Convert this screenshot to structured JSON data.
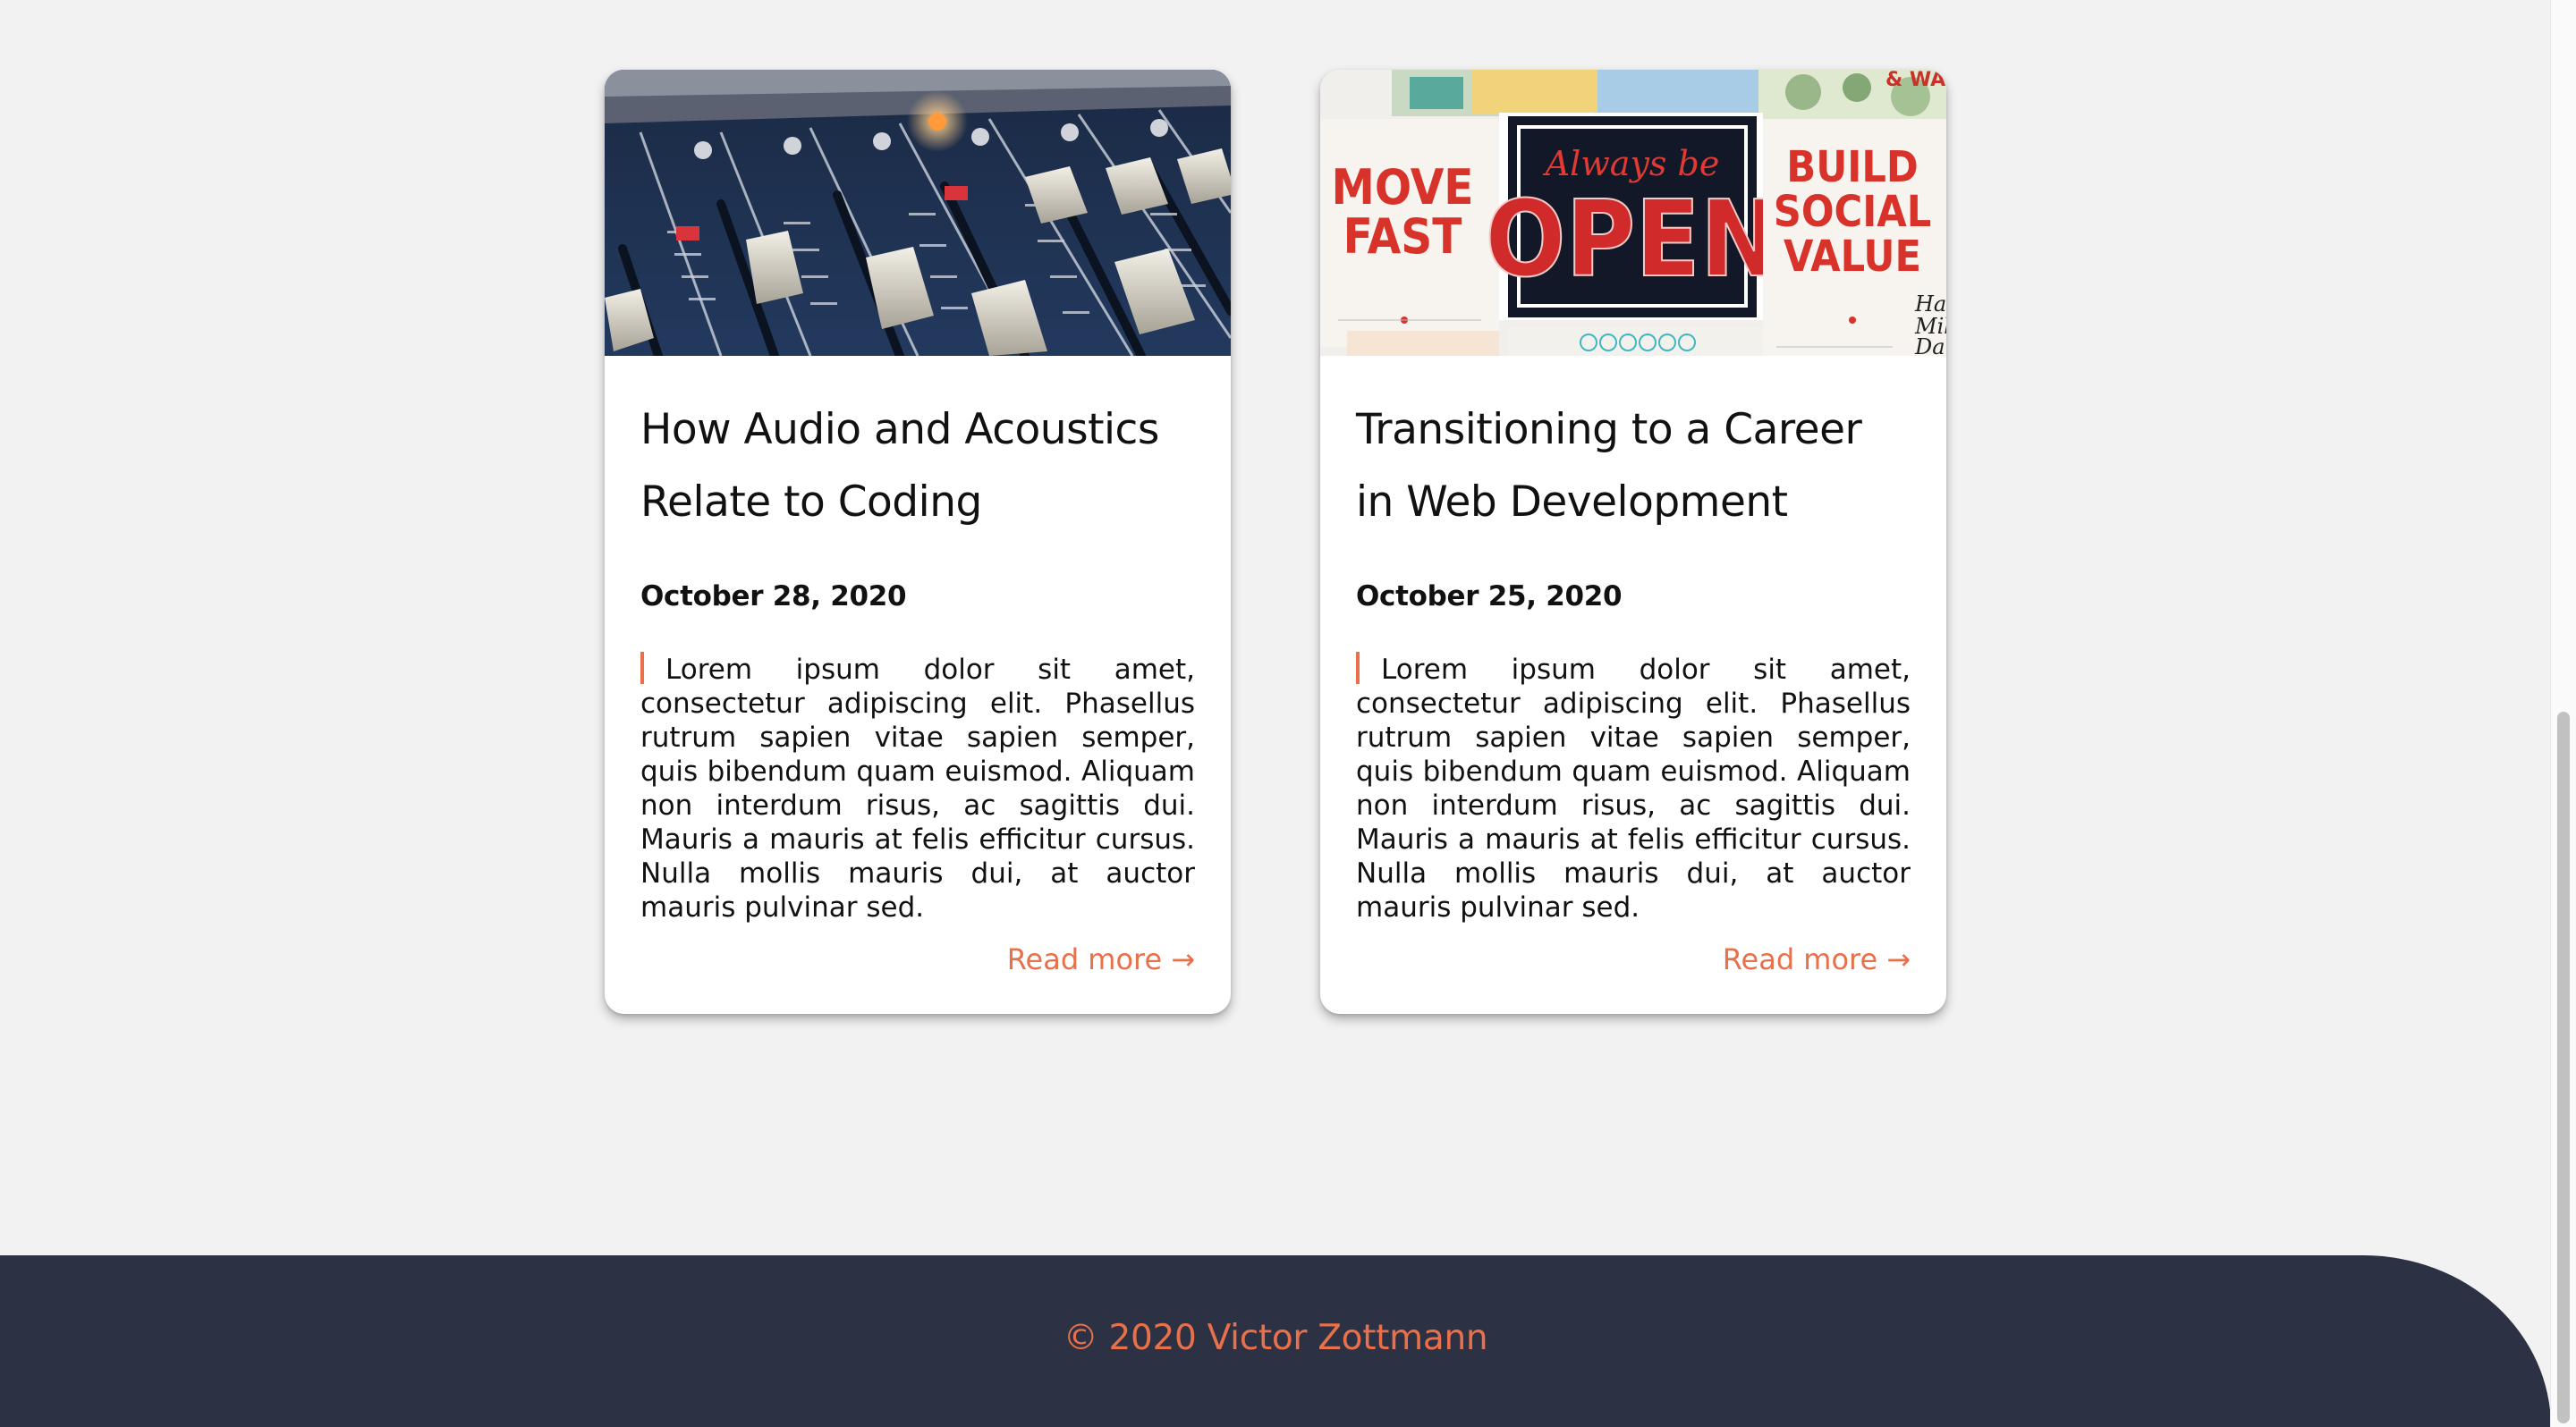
{
  "posts": [
    {
      "title": "How Audio and Acoustics Relate to Coding",
      "date": "October 28, 2020",
      "excerpt": "Lorem ipsum dolor sit amet, consectetur adipiscing elit. Phasellus rutrum sapien vitae sapien semper, quis bibendum quam euismod. Aliquam non interdum risus, ac sagittis dui. Mauris a mauris at felis efficitur cursus. Nulla mollis mauris dui, at auctor mauris pulvinar sed.",
      "read_more": "Read more",
      "arrow": "→"
    },
    {
      "title": "Transitioning to a Career in Web Development",
      "date": "October 25, 2020",
      "excerpt": "Lorem ipsum dolor sit amet, consectetur adipiscing elit. Phasellus rutrum sapien vitae sapien semper, quis bibendum quam euismod. Aliquam non interdum risus, ac sagittis dui. Mauris a mauris at felis efficitur cursus. Nulla mollis mauris dui, at auctor mauris pulvinar sed.",
      "read_more": "Read more",
      "arrow": "→",
      "image_text": {
        "sign_top": "Always be",
        "sign_main": "OPEN",
        "left_poster": [
          "MOVE",
          "FAST"
        ],
        "right_poster": [
          "BUILD",
          "SOCIAL",
          "VALUE"
        ]
      }
    }
  ],
  "footer": {
    "copyright": "© 2020 Victor Zottmann"
  },
  "colors": {
    "accent": "#e8704a",
    "footer_bg": "#2c3143",
    "page_bg": "#f2f2f2"
  }
}
